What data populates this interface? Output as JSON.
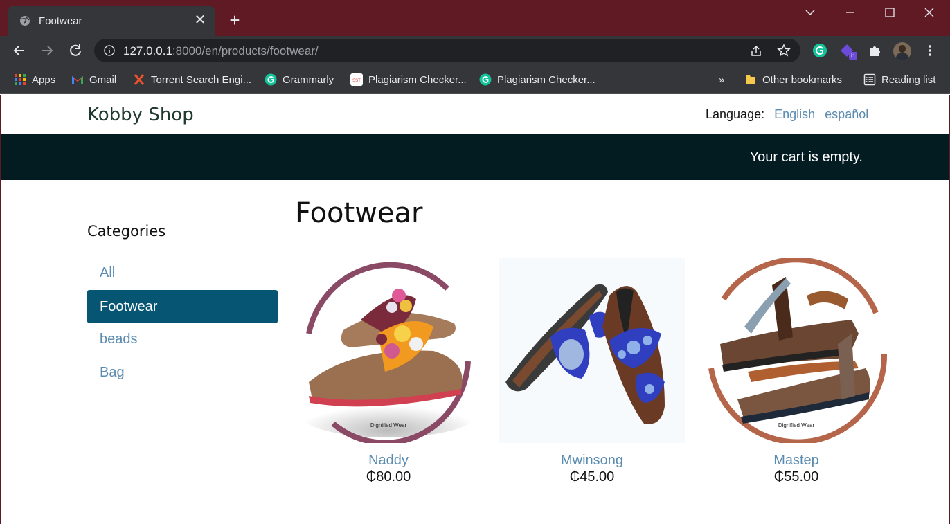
{
  "browser": {
    "tab_title": "Footwear",
    "tab_close": "✕",
    "new_tab": "+",
    "url_host": "127.0.0.1",
    "url_rest": ":8000/en/products/footwear/",
    "extension_badge": "8",
    "window_controls": [
      "chevron-down",
      "minimize",
      "maximize",
      "close"
    ],
    "bookmarks": [
      {
        "label": "Apps",
        "icon": "apps-grid-icon"
      },
      {
        "label": "Gmail",
        "icon": "gmail-icon"
      },
      {
        "label": "Torrent Search Engi...",
        "icon": "x-icon"
      },
      {
        "label": "Grammarly",
        "icon": "grammarly-icon"
      },
      {
        "label": "Plagiarism Checker...",
        "icon": "sst-icon"
      },
      {
        "label": "Plagiarism Checker...",
        "icon": "grammarly-icon"
      }
    ],
    "more_bookmarks": "»",
    "other_bookmarks": "Other bookmarks",
    "reading_list": "Reading list"
  },
  "site": {
    "logo": "Kobby Shop",
    "language_label": "Language:",
    "languages": [
      "English",
      "español"
    ],
    "cart_message": "Your cart is empty."
  },
  "sidebar": {
    "title": "Categories",
    "items": [
      {
        "label": "All",
        "active": false
      },
      {
        "label": "Footwear",
        "active": true
      },
      {
        "label": "beads",
        "active": false
      },
      {
        "label": "Bag",
        "active": false
      }
    ]
  },
  "main": {
    "heading": "Footwear",
    "products": [
      {
        "name": "Naddy",
        "price": "₵80.00",
        "caption": "Dignified Wear",
        "ring_color": "#8a4a66"
      },
      {
        "name": "Mwinsong",
        "price": "₵45.00",
        "caption": "",
        "ring_color": "#ffffff"
      },
      {
        "name": "Mastep",
        "price": "₵55.00",
        "caption": "Dignified Wear",
        "ring_color": "#b5664a"
      }
    ]
  },
  "colors": {
    "titlebar": "#5f1a24",
    "cart_bar": "#031c22",
    "active_category": "#065573",
    "link": "#5a8bb0"
  }
}
